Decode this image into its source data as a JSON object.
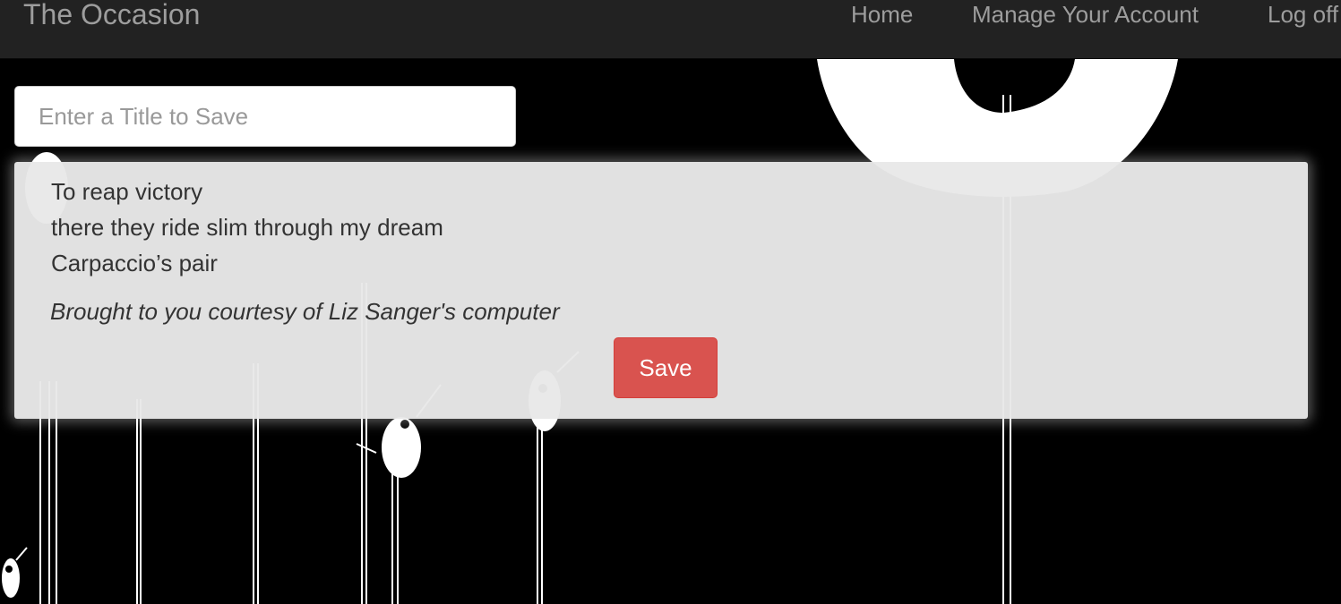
{
  "navbar": {
    "brand": "The Occasion",
    "links": [
      "Home",
      "Manage Your Account",
      "Log off"
    ]
  },
  "title_input": {
    "placeholder": "Enter a Title to Save",
    "value": ""
  },
  "poem": {
    "lines": [
      "To reap victory",
      "there they ride slim through my dream",
      "Carpaccio’s pair"
    ],
    "credit": "Brought to you courtesy of Liz Sanger's computer"
  },
  "save_button": {
    "label": "Save",
    "color": "#d9534f"
  },
  "colors": {
    "navbar_bg": "#222222",
    "nav_text": "#9d9d9d",
    "page_bg": "#000000",
    "panel_bg": "#e8e8e8"
  }
}
